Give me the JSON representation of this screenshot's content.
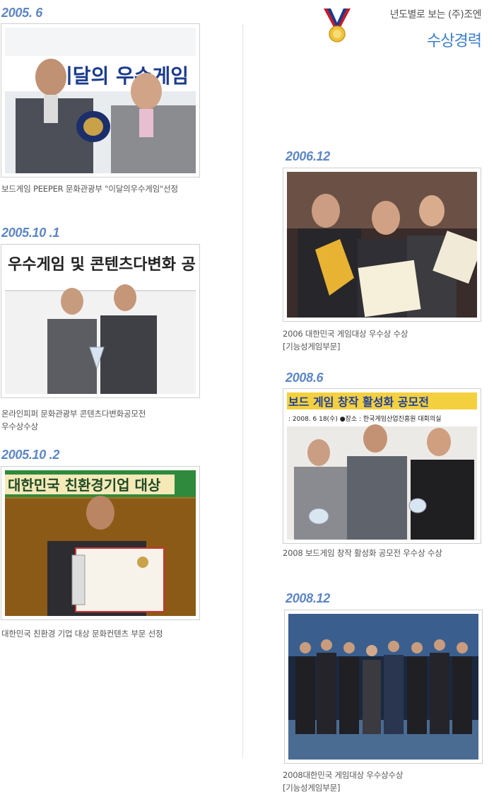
{
  "header": {
    "subtitle": "년도별로 보는 (주)조엔",
    "title": "수상경력",
    "medal_icon": "medal-icon"
  },
  "awards": [
    {
      "year": "2005. 6",
      "caption_lines": [
        "보드게임 PEEPER 문화관광부 \"이달의우수게임\"선정"
      ],
      "banner": "이달의 우수게임"
    },
    {
      "year": "2005.10 .1",
      "caption_lines": [
        "온라인피퍼 문화관광부 콘텐츠다변화공모전",
        "우수상수상"
      ],
      "banner": "우수게임 및 콘텐츠다변화 공"
    },
    {
      "year": "2005.10 .2",
      "caption_lines": [
        "대한민국 친환경 기업 대상 문화컨텐츠 부문 선정"
      ],
      "banner": "대한민국 친환경기업 대상"
    },
    {
      "year": "2006.12",
      "caption_lines": [
        "2006 대한민국 게임대상 우수상 수상",
        "[기능성게임부문]"
      ]
    },
    {
      "year": "2008.6",
      "caption_lines": [
        "2008 보드게임 창작 활성화 공모전 우수상 수상"
      ],
      "banner": "보드 게임 창작 활성화 공모전",
      "banner_sub": ": 2008. 6 18(수)   ●장소 : 한국게임산업진흥원 대회의실"
    },
    {
      "year": "2008.12",
      "caption_lines": [
        "2008대한민국 게임대상 우수상수상",
        "[기능성게임부문]"
      ]
    }
  ],
  "colors": {
    "year_text": "#5d86c4",
    "title_text": "#3d7fc9",
    "caption_text": "#555555",
    "frame_border": "#cfcfcf"
  }
}
